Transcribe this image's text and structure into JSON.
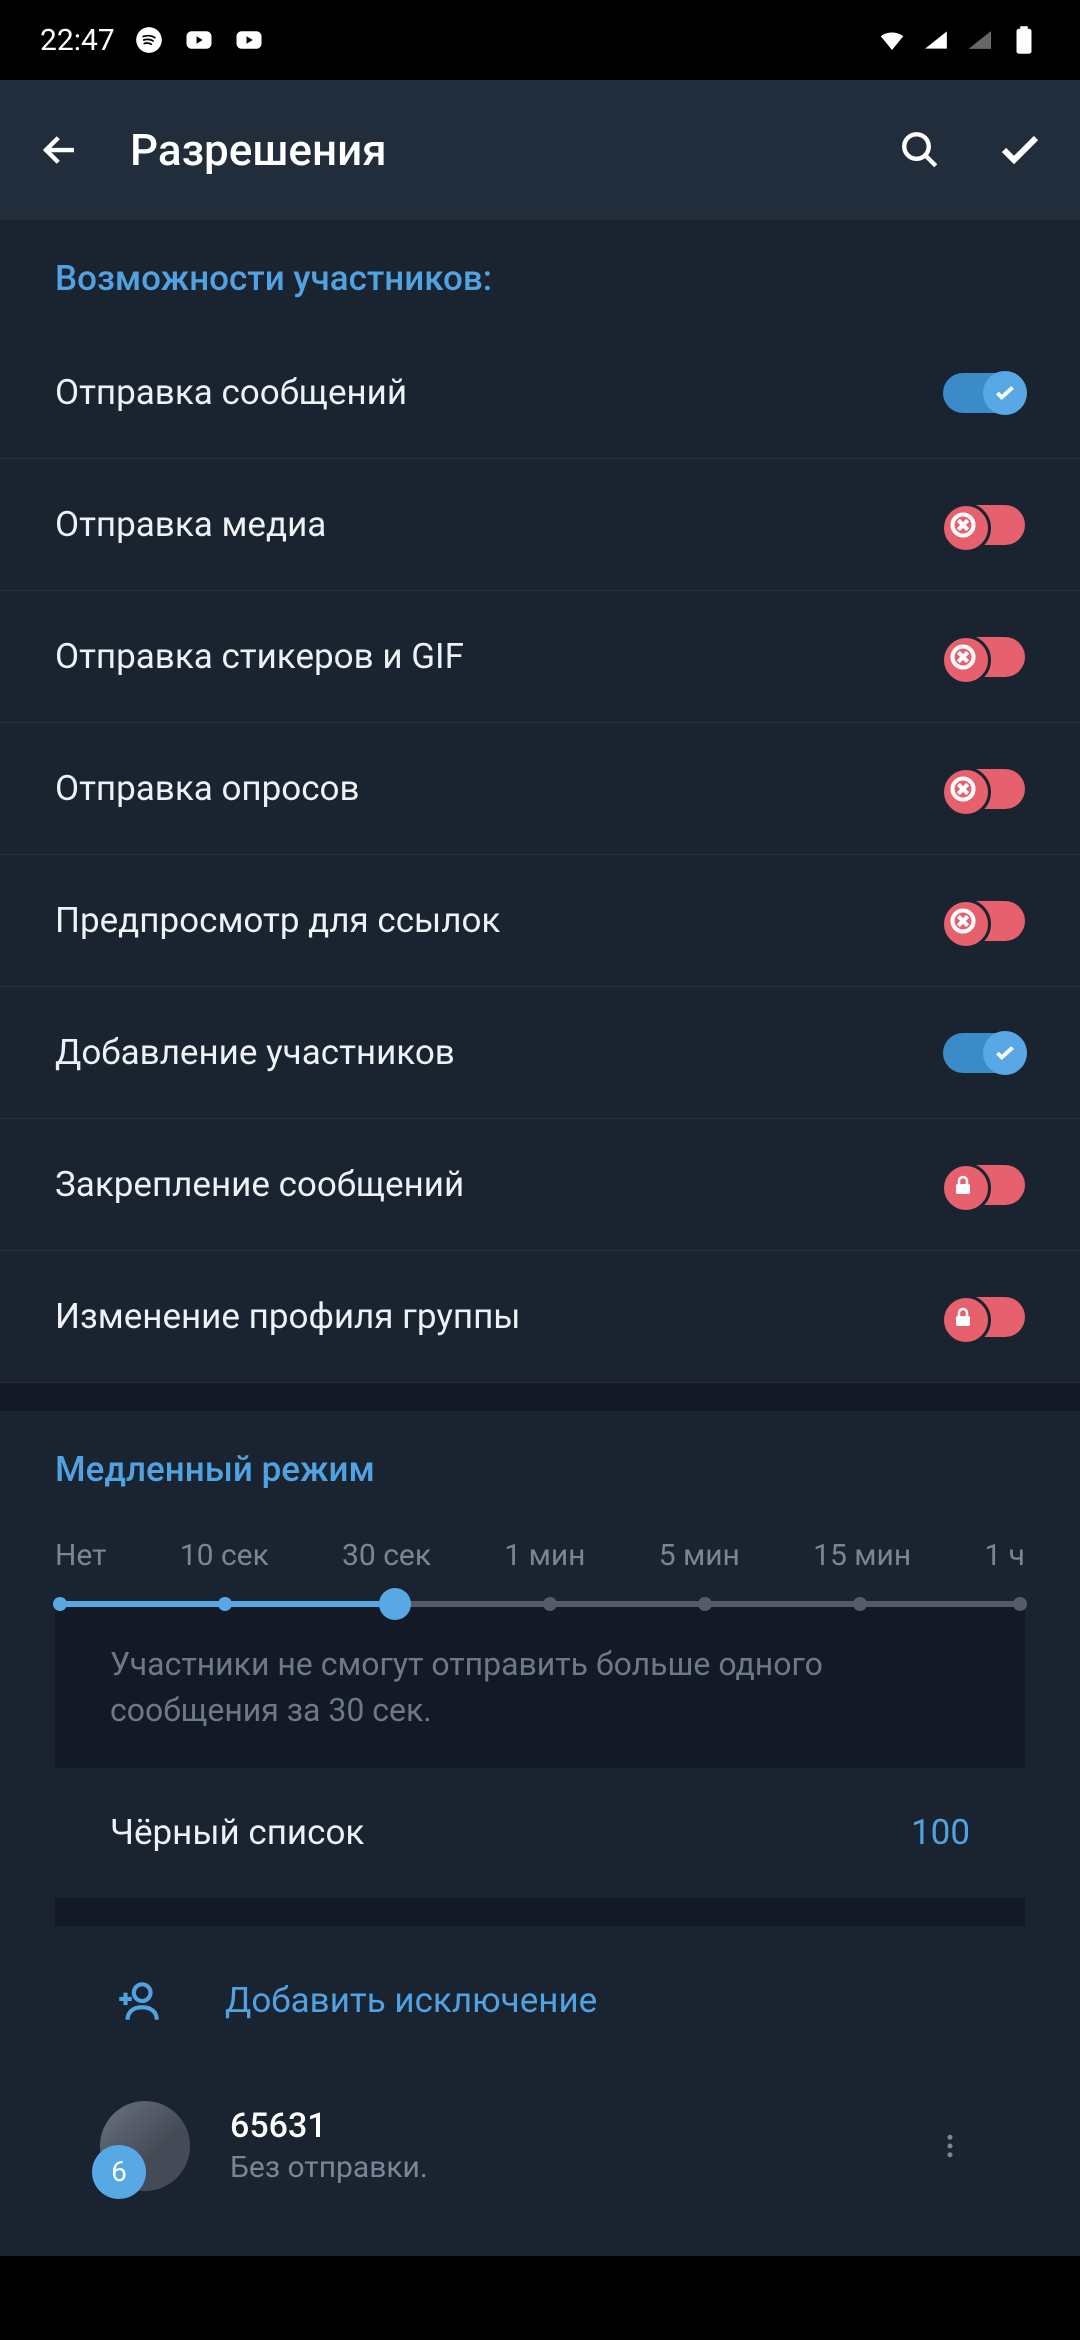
{
  "status": {
    "time": "22:47"
  },
  "header": {
    "title": "Разрешения"
  },
  "permissions": {
    "section_title": "Возможности участников:",
    "items": [
      {
        "label": "Отправка сообщений",
        "state": "on"
      },
      {
        "label": "Отправка медиа",
        "state": "off"
      },
      {
        "label": "Отправка стикеров и GIF",
        "state": "off"
      },
      {
        "label": "Отправка опросов",
        "state": "off"
      },
      {
        "label": "Предпросмотр для ссылок",
        "state": "off"
      },
      {
        "label": "Добавление участников",
        "state": "on"
      },
      {
        "label": "Закрепление сообщений",
        "state": "lock"
      },
      {
        "label": "Изменение профиля группы",
        "state": "lock"
      }
    ]
  },
  "slowmode": {
    "title": "Медленный режим",
    "labels": [
      "Нет",
      "10 сек",
      "30 сек",
      "1 мин",
      "5 мин",
      "15 мин",
      "1 ч"
    ],
    "selected_index": 2,
    "description": "Участники не смогут отправить больше одного сообщения за 30 сек."
  },
  "blacklist": {
    "label": "Чёрный список",
    "count": "100"
  },
  "exception": {
    "label": "Добавить исключение"
  },
  "user": {
    "name": "65631",
    "subtitle": "Без отправки.",
    "badge": "6"
  }
}
